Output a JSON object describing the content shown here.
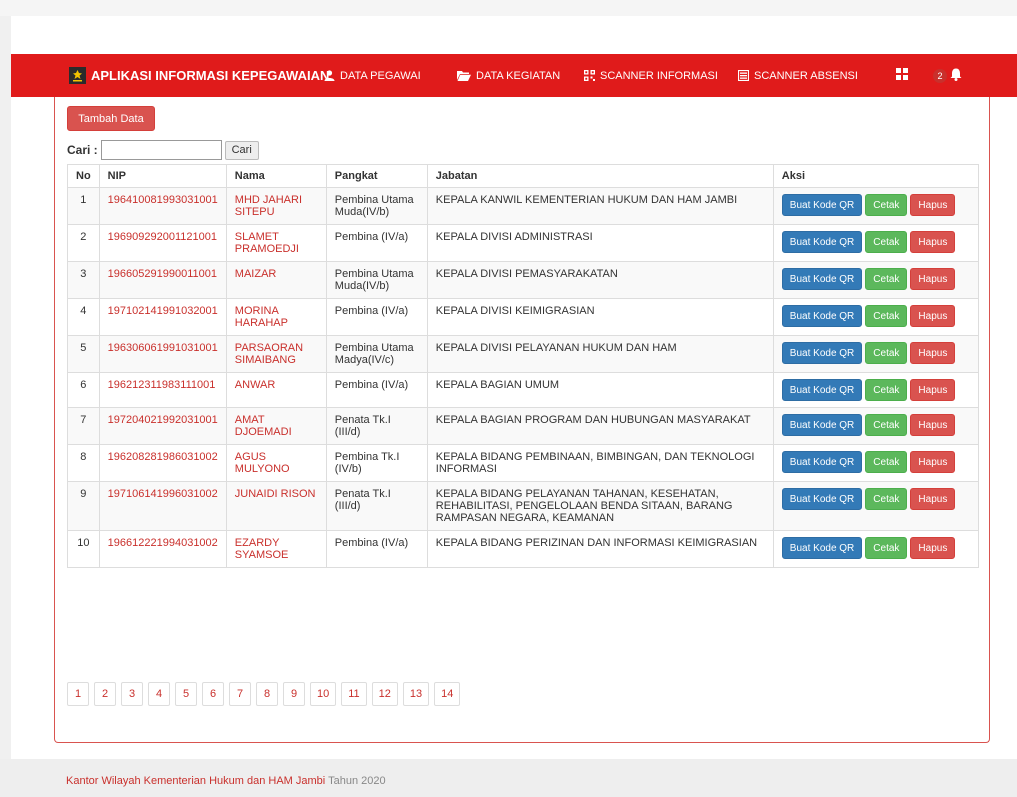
{
  "app": {
    "title": "APLIKASI INFORMASI KEPEGAWAIAN"
  },
  "nav": {
    "items": [
      {
        "label": "DATA PEGAWAI",
        "icon": "user-icon"
      },
      {
        "label": "DATA KEGIATAN",
        "icon": "folder-open-icon"
      },
      {
        "label": "SCANNER INFORMASI",
        "icon": "qrcode-icon"
      },
      {
        "label": "SCANNER ABSENSI",
        "icon": "list-alt-icon"
      }
    ],
    "grid_icon": "grid-icon",
    "notification_count": "2",
    "bell_icon": "bell-icon"
  },
  "toolbar": {
    "add_label": "Tambah Data",
    "search_label": "Cari :",
    "search_value": "",
    "search_button": "Cari"
  },
  "table": {
    "headers": [
      "No",
      "NIP",
      "Nama",
      "Pangkat",
      "Jabatan",
      "Aksi"
    ],
    "action_labels": {
      "qr": "Buat Kode QR",
      "print": "Cetak",
      "delete": "Hapus"
    },
    "rows": [
      {
        "no": "1",
        "nip": "196410081993031001",
        "nama": "MHD JAHARI SITEPU",
        "pangkat": "Pembina Utama Muda(IV/b)",
        "jabatan": "KEPALA KANWIL KEMENTERIAN HUKUM DAN HAM JAMBI"
      },
      {
        "no": "2",
        "nip": "196909292001121001",
        "nama": "SLAMET PRAMOEDJI",
        "pangkat": "Pembina (IV/a)",
        "jabatan": "KEPALA DIVISI ADMINISTRASI"
      },
      {
        "no": "3",
        "nip": "196605291990011001",
        "nama": "MAIZAR",
        "pangkat": "Pembina Utama Muda(IV/b)",
        "jabatan": "KEPALA DIVISI PEMASYARAKATAN"
      },
      {
        "no": "4",
        "nip": "197102141991032001",
        "nama": "MORINA HARAHAP",
        "pangkat": "Pembina (IV/a)",
        "jabatan": "KEPALA DIVISI KEIMIGRASIAN"
      },
      {
        "no": "5",
        "nip": "196306061991031001",
        "nama": "PARSAORAN SIMAIBANG",
        "pangkat": "Pembina Utama Madya(IV/c)",
        "jabatan": "KEPALA DIVISI PELAYANAN HUKUM DAN HAM"
      },
      {
        "no": "6",
        "nip": "196212311983111001",
        "nama": "ANWAR",
        "pangkat": "Pembina (IV/a)",
        "jabatan": "KEPALA BAGIAN UMUM"
      },
      {
        "no": "7",
        "nip": "197204021992031001",
        "nama": "AMAT DJOEMADI",
        "pangkat": "Penata Tk.I (III/d)",
        "jabatan": "KEPALA BAGIAN PROGRAM DAN HUBUNGAN MASYARAKAT"
      },
      {
        "no": "8",
        "nip": "196208281986031002",
        "nama": "AGUS MULYONO",
        "pangkat": "Pembina Tk.I (IV/b)",
        "jabatan": "KEPALA BIDANG PEMBINAAN, BIMBINGAN, DAN TEKNOLOGI INFORMASI"
      },
      {
        "no": "9",
        "nip": "197106141996031002",
        "nama": "JUNAIDI RISON",
        "pangkat": "Penata Tk.I (III/d)",
        "jabatan": "KEPALA BIDANG PELAYANAN TAHANAN, KESEHATAN, REHABILITASI, PENGELOLAAN BENDA SITAAN, BARANG RAMPASAN NEGARA, KEAMANAN"
      },
      {
        "no": "10",
        "nip": "196612221994031002",
        "nama": "EZARDY SYAMSOE",
        "pangkat": "Pembina (IV/a)",
        "jabatan": "KEPALA BIDANG PERIZINAN DAN INFORMASI KEIMIGRASIAN"
      }
    ]
  },
  "pagination": {
    "pages": [
      "1",
      "2",
      "3",
      "4",
      "5",
      "6",
      "7",
      "8",
      "9",
      "10",
      "11",
      "12",
      "13",
      "14"
    ]
  },
  "footer": {
    "org": "Kantor Wilayah Kementerian Hukum dan HAM Jambi",
    "year": "Tahun 2020"
  },
  "colors": {
    "brand_red": "#e01b1b",
    "link_red": "#c9302c",
    "primary": "#337ab7",
    "success": "#5cb85c",
    "danger": "#d9534f"
  }
}
